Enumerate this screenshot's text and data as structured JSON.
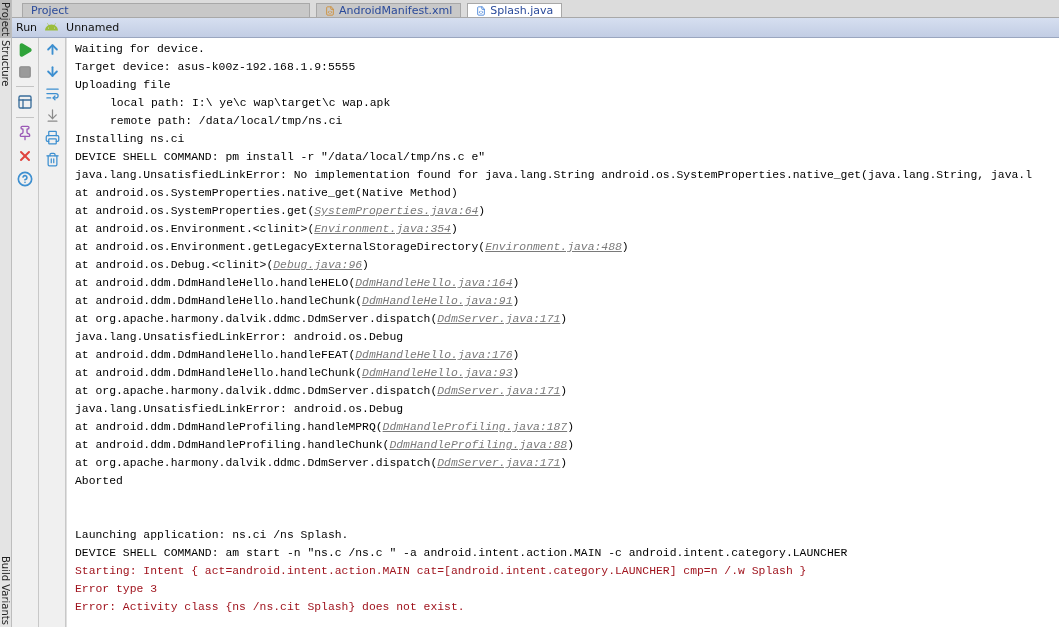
{
  "editor_tabs": [
    {
      "label": "Project",
      "kind": "panel",
      "selected": false
    },
    {
      "label": "AndroidManifest.xml",
      "kind": "xml",
      "selected": false
    },
    {
      "label": "Splash.java",
      "kind": "java",
      "selected": true
    }
  ],
  "side_tabs": [
    {
      "label": "Project",
      "selected": true
    },
    {
      "label": "Structure",
      "selected": false
    },
    {
      "label": "Build Variants",
      "selected": false
    }
  ],
  "run_panel": {
    "title": "Run",
    "config": "Unnamed"
  },
  "console": [
    {
      "kind": "plain",
      "text": "Waiting for device."
    },
    {
      "kind": "plain",
      "text": "Target device: asus-k00z-192.168.1.9:5555"
    },
    {
      "kind": "plain",
      "text": "Uploading file"
    },
    {
      "kind": "indented",
      "text": "local path: I:\\ ye\\c wap\\target\\c wap.apk"
    },
    {
      "kind": "indented",
      "text": "remote path: /data/local/tmp/ns.ci"
    },
    {
      "kind": "plain",
      "text": "Installing ns.ci"
    },
    {
      "kind": "plain",
      "text": "DEVICE SHELL COMMAND: pm install -r \"/data/local/tmp/ns.c e\""
    },
    {
      "kind": "plain",
      "text": "java.lang.UnsatisfiedLinkError: No implementation found for java.lang.String android.os.SystemProperties.native_get(java.lang.String, java.l"
    },
    {
      "kind": "plain",
      "text": "at android.os.SystemProperties.native_get(Native Method)"
    },
    {
      "kind": "plain",
      "text": "at android.os.SystemProperties.get(",
      "link": "SystemProperties.java:64",
      "tail": ")"
    },
    {
      "kind": "plain",
      "text": "at android.os.Environment.<clinit>(",
      "link": "Environment.java:354",
      "tail": ")"
    },
    {
      "kind": "plain",
      "text": "at android.os.Environment.getLegacyExternalStorageDirectory(",
      "link": "Environment.java:488",
      "tail": ")"
    },
    {
      "kind": "plain",
      "text": "at android.os.Debug.<clinit>(",
      "link": "Debug.java:96",
      "tail": ")"
    },
    {
      "kind": "plain",
      "text": "at android.ddm.DdmHandleHello.handleHELO(",
      "link": "DdmHandleHello.java:164",
      "tail": ")"
    },
    {
      "kind": "plain",
      "text": "at android.ddm.DdmHandleHello.handleChunk(",
      "link": "DdmHandleHello.java:91",
      "tail": ")"
    },
    {
      "kind": "plain",
      "text": "at org.apache.harmony.dalvik.ddmc.DdmServer.dispatch(",
      "link": "DdmServer.java:171",
      "tail": ")"
    },
    {
      "kind": "plain",
      "text": "java.lang.UnsatisfiedLinkError: android.os.Debug"
    },
    {
      "kind": "plain",
      "text": "at android.ddm.DdmHandleHello.handleFEAT(",
      "link": "DdmHandleHello.java:176",
      "tail": ")"
    },
    {
      "kind": "plain",
      "text": "at android.ddm.DdmHandleHello.handleChunk(",
      "link": "DdmHandleHello.java:93",
      "tail": ")"
    },
    {
      "kind": "plain",
      "text": "at org.apache.harmony.dalvik.ddmc.DdmServer.dispatch(",
      "link": "DdmServer.java:171",
      "tail": ")"
    },
    {
      "kind": "plain",
      "text": "java.lang.UnsatisfiedLinkError: android.os.Debug"
    },
    {
      "kind": "plain",
      "text": "at android.ddm.DdmHandleProfiling.handleMPRQ(",
      "link": "DdmHandleProfiling.java:187",
      "tail": ")"
    },
    {
      "kind": "plain",
      "text": "at android.ddm.DdmHandleProfiling.handleChunk(",
      "link": "DdmHandleProfiling.java:88",
      "tail": ")"
    },
    {
      "kind": "plain",
      "text": "at org.apache.harmony.dalvik.ddmc.DdmServer.dispatch(",
      "link": "DdmServer.java:171",
      "tail": ")"
    },
    {
      "kind": "plain",
      "text": "Aborted"
    },
    {
      "kind": "blank"
    },
    {
      "kind": "blank"
    },
    {
      "kind": "plain",
      "text": "Launching application: ns.ci /ns Splash."
    },
    {
      "kind": "plain",
      "text": "DEVICE SHELL COMMAND: am start -n \"ns.c /ns.c \" -a android.intent.action.MAIN -c android.intent.category.LAUNCHER"
    },
    {
      "kind": "error",
      "text": "Starting: Intent { act=android.intent.action.MAIN cat=[android.intent.category.LAUNCHER] cmp=n /.w Splash }"
    },
    {
      "kind": "error",
      "text": "Error type 3"
    },
    {
      "kind": "error",
      "text": "Error: Activity class {ns /ns.cit Splash} does not exist."
    }
  ]
}
